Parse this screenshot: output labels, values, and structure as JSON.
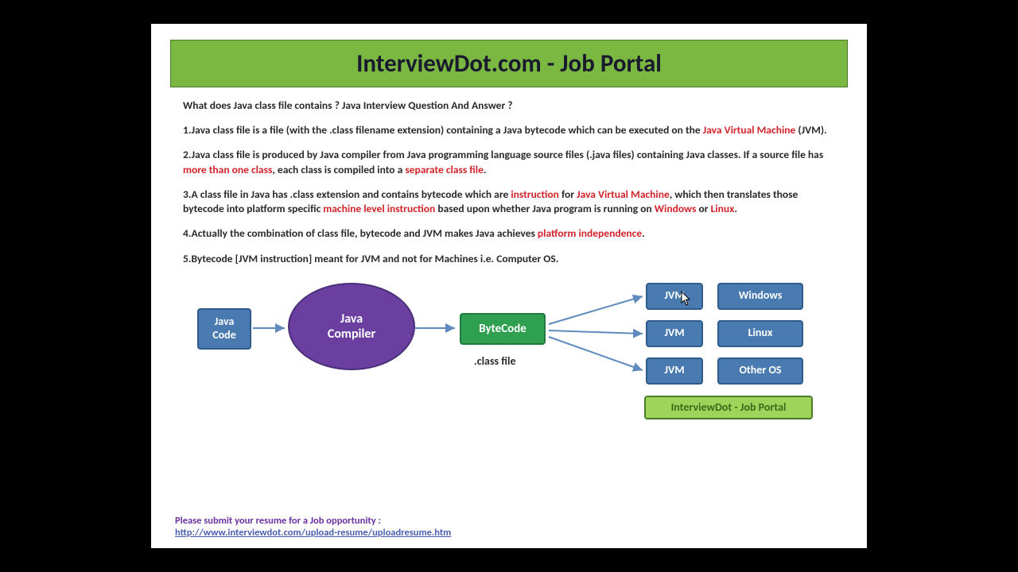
{
  "header": {
    "title": "InterviewDot.com - Job Portal"
  },
  "question": "What does Java class file contains ? Java Interview Question And Answer ?",
  "points": {
    "p1a": "1.Java class file is a file (with the .class filename extension) containing a Java bytecode which can be executed on the ",
    "p1_hl": "Java Virtual Machine",
    "p1b": " (JVM).",
    "p2a": "2.Java class file is produced by Java compiler from Java programming language source files (.java files) containing Java classes. If a source file has ",
    "p2_hl1": "more than one class",
    "p2b": ", each class is compiled into a ",
    "p2_hl2": "separate class file",
    "p2c": ".",
    "p3a": "3.A class file in Java has .class extension and contains bytecode which are ",
    "p3_hl1": "instruction",
    "p3b": " for ",
    "p3_hl2": "Java Virtual Machine",
    "p3c": ", which then translates those bytecode into platform specific ",
    "p3_hl3": "machine level instruction",
    "p3d": " based upon whether Java program is running on ",
    "p3_hl4": "Windows",
    "p3e": " or ",
    "p3_hl5": "Linux",
    "p3f": ".",
    "p4a": "4.Actually the combination of class file, bytecode and JVM makes Java achieves ",
    "p4_hl": "platform independence",
    "p4b": ".",
    "p5": "5.Bytecode [JVM instruction] meant for JVM and not for Machines i.e. Computer OS."
  },
  "diagram": {
    "java_code": "Java\nCode",
    "compiler": "Java\nCompiler",
    "bytecode": "ByteCode",
    "classfile": ".class file",
    "jvm": "JVM",
    "windows": "Windows",
    "linux": "Linux",
    "otheros": "Other OS",
    "portal": "InterviewDot - Job Portal"
  },
  "footer": {
    "prompt": "Please submit your resume for a Job opportunity :",
    "link": "http://www.interviewdot.com/upload-resume/uploadresume.htm"
  }
}
